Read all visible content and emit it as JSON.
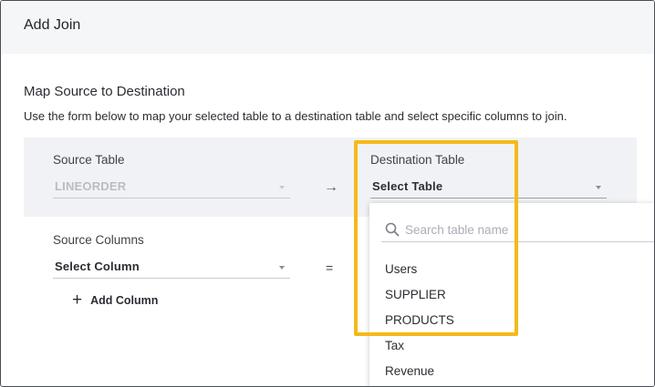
{
  "dialog": {
    "title": "Add Join"
  },
  "section": {
    "title": "Map Source to Destination",
    "description": "Use the form below to map your selected table to a destination table and select specific columns to join."
  },
  "source_table": {
    "label": "Source Table",
    "value": "LINEORDER"
  },
  "destination_table": {
    "label": "Destination Table",
    "value": "Select Table"
  },
  "mapping_arrow": "→",
  "source_columns": {
    "label": "Source Columns",
    "value": "Select Column"
  },
  "equals_sign": "=",
  "add_column": {
    "label": "Add Column"
  },
  "table_dropdown": {
    "search_placeholder": "Search table name",
    "options": [
      "Users",
      "SUPPLIER",
      "PRODUCTS",
      "Tax",
      "Revenue"
    ]
  },
  "colors": {
    "highlight": "#f6b919",
    "header_bg": "#f5f6f8",
    "band_bg": "#f1f2f5"
  },
  "icons": [
    "search-icon",
    "chevron-down-icon",
    "arrow-right-icon",
    "plus-icon"
  ]
}
